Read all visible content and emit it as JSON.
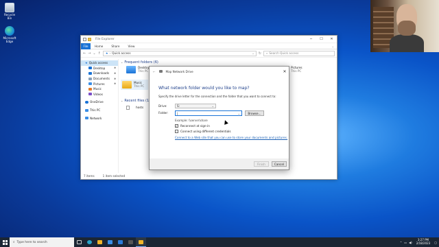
{
  "desktop": {
    "icons": [
      {
        "label": "Recycle Bin",
        "icon": "recycle-bin-icon"
      },
      {
        "label": "Microsoft Edge",
        "icon": "edge-icon"
      }
    ]
  },
  "explorer": {
    "title": "File Explorer",
    "ribbon_tabs": [
      "File",
      "Home",
      "Share",
      "View"
    ],
    "address": "Quick access",
    "search_placeholder": "Search Quick access",
    "nav": [
      {
        "label": "Quick access",
        "icon": "star-icon",
        "color": "#1a73d6"
      },
      {
        "label": "Desktop",
        "icon": "desktop-icon",
        "color": "#1a73d6",
        "pinned": true
      },
      {
        "label": "Downloads",
        "icon": "downloads-icon",
        "color": "#1a73d6",
        "pinned": true
      },
      {
        "label": "Documents",
        "icon": "documents-icon",
        "color": "#8aa0b8",
        "pinned": true
      },
      {
        "label": "Pictures",
        "icon": "pictures-icon",
        "color": "#3a8ee6",
        "pinned": true
      },
      {
        "label": "Music",
        "icon": "music-icon",
        "color": "#e37b2a"
      },
      {
        "label": "Videos",
        "icon": "videos-icon",
        "color": "#7a4fc8"
      },
      {
        "label": "OneDrive",
        "icon": "onedrive-icon",
        "color": "#1a73d6"
      },
      {
        "label": "This PC",
        "icon": "this-pc-icon",
        "color": "#3a8ee6"
      },
      {
        "label": "Network",
        "icon": "network-icon",
        "color": "#3a8ee6"
      }
    ],
    "frequent_header": "Frequent folders (6)",
    "folders": [
      {
        "name": "Desktop",
        "location": "This PC"
      },
      {
        "name": "Music",
        "location": "This PC"
      },
      {
        "name": "Pictures",
        "location": "This PC"
      }
    ],
    "recent_header": "Recent files (1)",
    "recent_files": [
      "hosts"
    ],
    "status_items": "7 items",
    "status_selected": "1 item selected"
  },
  "dialog": {
    "title": "Map Network Drive",
    "heading": "What network folder would you like to map?",
    "description": "Specify the drive letter for the connection and the folder that you want to connect to:",
    "drive_label": "Drive:",
    "drive_value": "S:",
    "folder_label": "Folder:",
    "folder_value": "|",
    "browse_label": "Browse...",
    "example": "Example: \\\\server\\share",
    "reconnect_label": "Reconnect at sign-in",
    "reconnect_checked": true,
    "credentials_label": "Connect using different credentials",
    "credentials_checked": false,
    "link": "Connect to a Web site that you can use to store your documents and pictures.",
    "finish_label": "Finish",
    "cancel_label": "Cancel"
  },
  "taskbar": {
    "search_placeholder": "Type here to search",
    "pinned": [
      {
        "icon": "task-view-icon",
        "color": "#d0d0d0"
      },
      {
        "icon": "edge-icon",
        "color": "#2aa3c8"
      },
      {
        "icon": "file-explorer-icon",
        "color": "#f0b429"
      },
      {
        "icon": "store-icon",
        "color": "#3a8ee6"
      },
      {
        "icon": "mail-icon",
        "color": "#2a7ad8"
      },
      {
        "icon": "camera-icon",
        "color": "#555555"
      },
      {
        "icon": "explorer-window-icon",
        "color": "#f0b429"
      }
    ],
    "time": "3:27 PM",
    "date": "2/18/2023"
  },
  "colors": {
    "accent": "#1a73d6",
    "heading": "#1e3f8a",
    "link": "#1a5fb4"
  }
}
